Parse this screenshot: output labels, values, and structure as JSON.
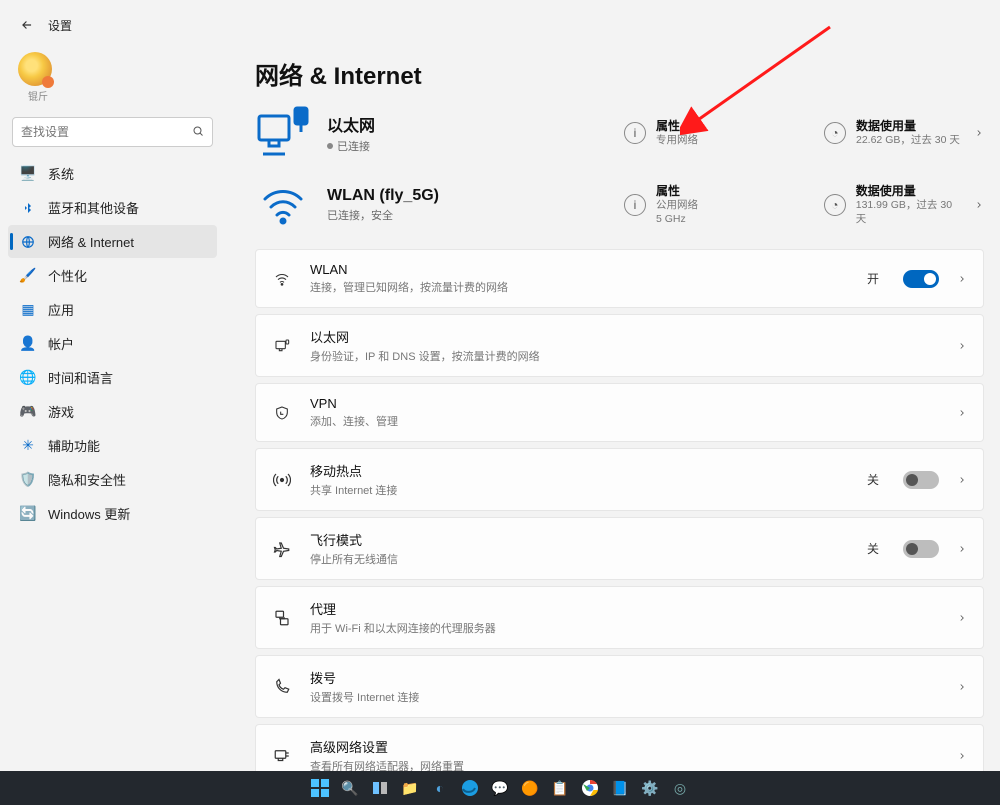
{
  "header": {
    "title": "设置"
  },
  "sidebar": {
    "search_placeholder": "查找设置",
    "avatar_label": "锟斤",
    "items": [
      {
        "label": "系统",
        "icon": "system"
      },
      {
        "label": "蓝牙和其他设备",
        "icon": "bluetooth"
      },
      {
        "label": "网络 & Internet",
        "icon": "network",
        "active": true
      },
      {
        "label": "个性化",
        "icon": "personalization"
      },
      {
        "label": "应用",
        "icon": "apps"
      },
      {
        "label": "帐户",
        "icon": "accounts"
      },
      {
        "label": "时间和语言",
        "icon": "time"
      },
      {
        "label": "游戏",
        "icon": "gaming"
      },
      {
        "label": "辅助功能",
        "icon": "accessibility"
      },
      {
        "label": "隐私和安全性",
        "icon": "privacy"
      },
      {
        "label": "Windows 更新",
        "icon": "update"
      }
    ]
  },
  "main": {
    "title": "网络 & Internet",
    "connections": [
      {
        "name": "以太网",
        "status": "已连接",
        "prop_title": "属性",
        "prop_sub": "专用网络",
        "data_title": "数据使用量",
        "data_sub": "22.62 GB，过去 30 天"
      },
      {
        "name": "WLAN (fly_5G)",
        "status": "已连接，安全",
        "prop_title": "属性",
        "prop_sub": "公用网络",
        "prop_sub2": "5 GHz",
        "data_title": "数据使用量",
        "data_sub": "131.99 GB，过去 30 天"
      }
    ],
    "rows": [
      {
        "title": "WLAN",
        "sub": "连接，管理已知网络，按流量计费的网络",
        "state": "开",
        "toggle": "on"
      },
      {
        "title": "以太网",
        "sub": "身份验证，IP 和 DNS 设置，按流量计费的网络"
      },
      {
        "title": "VPN",
        "sub": "添加、连接、管理"
      },
      {
        "title": "移动热点",
        "sub": "共享 Internet 连接",
        "state": "关",
        "toggle": "off"
      },
      {
        "title": "飞行模式",
        "sub": "停止所有无线通信",
        "state": "关",
        "toggle": "off"
      },
      {
        "title": "代理",
        "sub": "用于 Wi-Fi 和以太网连接的代理服务器"
      },
      {
        "title": "拨号",
        "sub": "设置拨号 Internet 连接"
      },
      {
        "title": "高级网络设置",
        "sub": "查看所有网络适配器，网络重置"
      }
    ]
  }
}
